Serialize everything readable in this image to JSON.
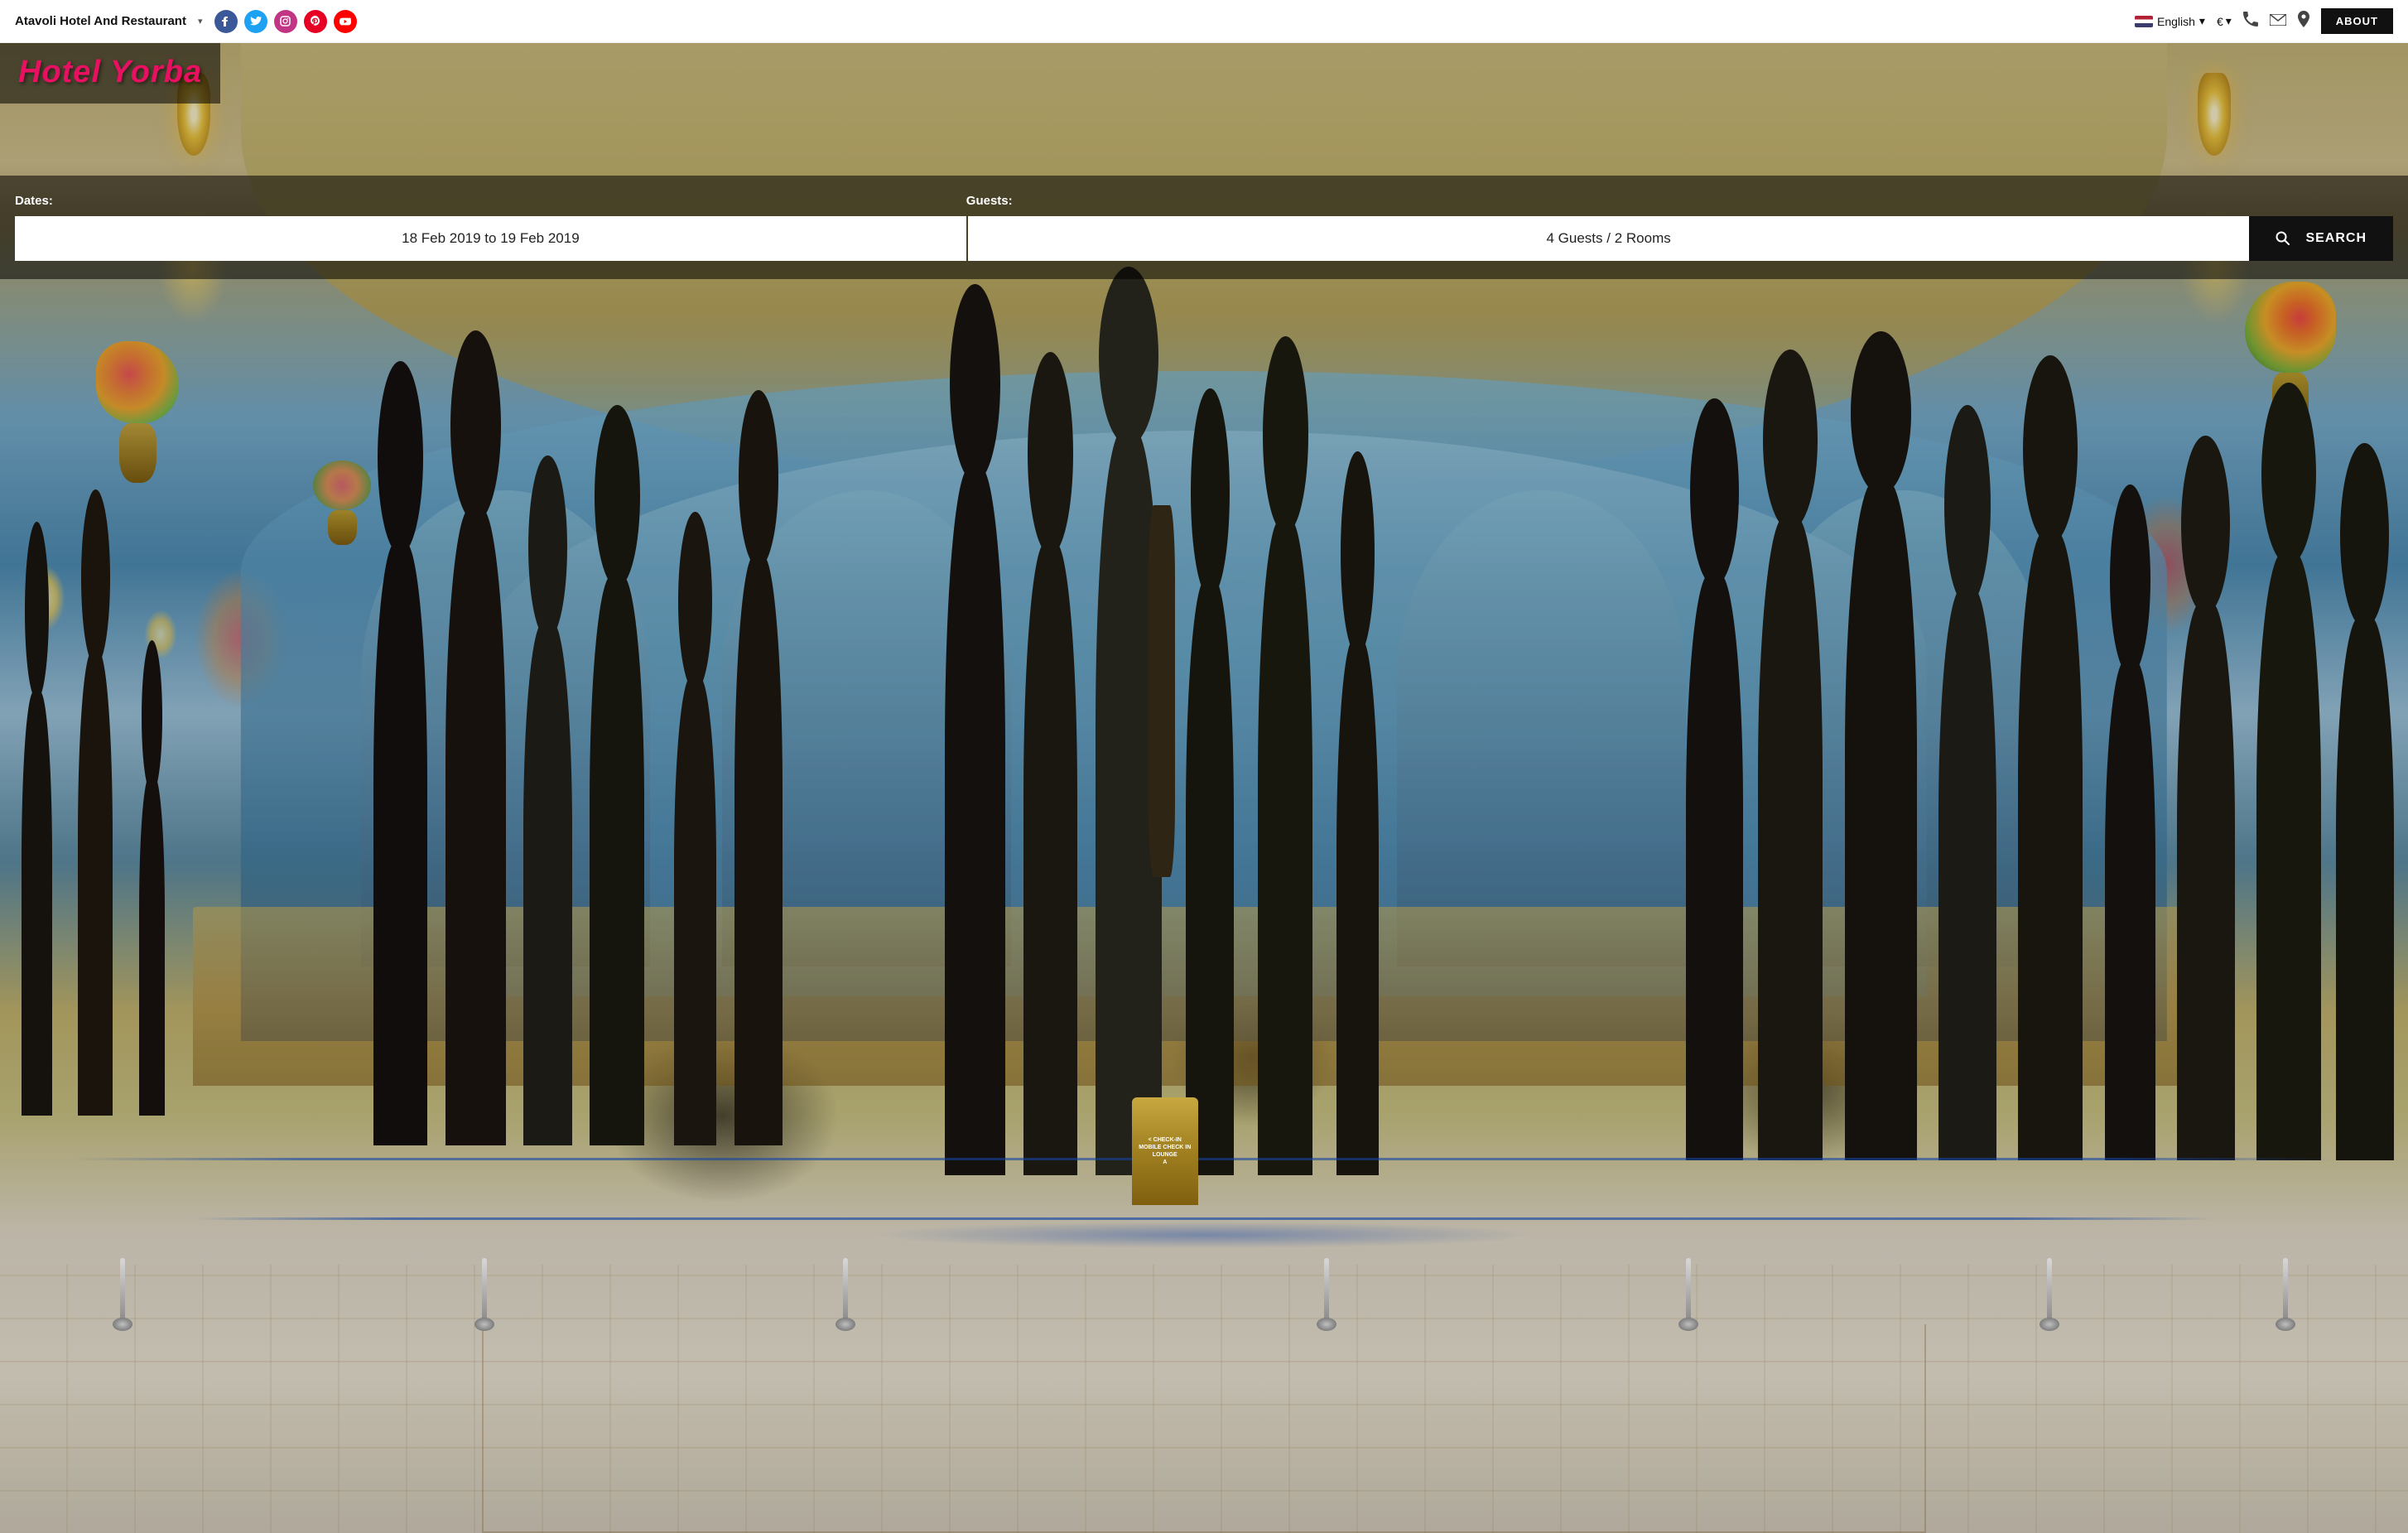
{
  "navbar": {
    "brand": "Atavoli Hotel And Restaurant",
    "brand_arrow": "▾",
    "social": {
      "facebook": "f",
      "twitter": "t",
      "instagram": "ig",
      "pinterest": "p",
      "youtube": "▶"
    },
    "language": {
      "label": "English",
      "arrow": "▾"
    },
    "currency": {
      "symbol": "€",
      "arrow": "▾"
    },
    "about_label": "ABOUT"
  },
  "hero": {
    "hotel_name": "Hotel Yorba",
    "dates_label": "Dates:",
    "guests_label": "Guests:",
    "date_value": "18 Feb 2019 to 19 Feb 2019",
    "guests_value": "4 Guests / 2 Rooms",
    "search_label": "SEARCH"
  }
}
